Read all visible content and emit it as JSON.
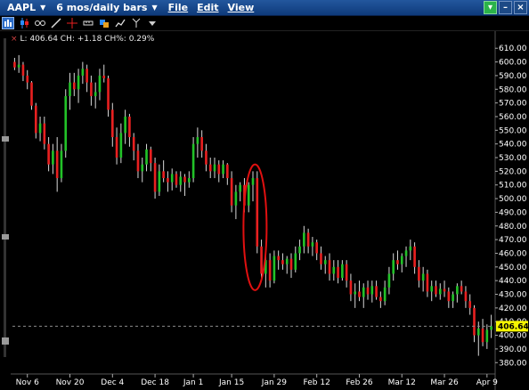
{
  "window": {
    "symbol": "AAPL",
    "period": "6 mos/daily bars",
    "menus": [
      "File",
      "Edit",
      "View"
    ]
  },
  "toolbar": {
    "icons": [
      "bar-chart-icon",
      "candlestick-icon",
      "link-icon",
      "line-icon",
      "crosshair-icon",
      "ruler-icon",
      "shape-icon",
      "trend-icon",
      "fork-icon",
      "dropdown-icon"
    ]
  },
  "status": {
    "close_marker": "×",
    "text": "L: 406.64 CH: +1.18 CH%: 0.29%"
  },
  "chart_data": {
    "type": "candlestick",
    "title": "",
    "last_price": "406.64",
    "ylim": [
      373,
      616
    ],
    "y_ticks": [
      "610.00",
      "600.00",
      "590.00",
      "580.00",
      "570.00",
      "560.00",
      "550.00",
      "540.00",
      "530.00",
      "520.00",
      "510.00",
      "500.00",
      "490.00",
      "480.00",
      "470.00",
      "460.00",
      "450.00",
      "440.00",
      "430.00",
      "420.00",
      "410.00",
      "400.00",
      "390.00",
      "380.00"
    ],
    "x_ticks": [
      {
        "label": "Nov 6",
        "index": 3
      },
      {
        "label": "Nov 20",
        "index": 13
      },
      {
        "label": "Dec 4",
        "index": 23
      },
      {
        "label": "Dec 18",
        "index": 33
      },
      {
        "label": "Jan 1",
        "index": 42
      },
      {
        "label": "Jan 15",
        "index": 51
      },
      {
        "label": "Jan 29",
        "index": 61
      },
      {
        "label": "Feb 12",
        "index": 71
      },
      {
        "label": "Feb 26",
        "index": 81
      },
      {
        "label": "Mar 12",
        "index": 91
      },
      {
        "label": "Mar 26",
        "index": 101
      },
      {
        "label": "Apr 9",
        "index": 111
      }
    ],
    "colors": {
      "up": "#22c228",
      "down": "#e82020",
      "highlight": "#e01010",
      "last_box": "#f5f500"
    },
    "candles": [
      [
        600,
        603,
        594,
        596
      ],
      [
        596,
        605,
        592,
        598
      ],
      [
        598,
        600,
        586,
        590
      ],
      [
        590,
        594,
        580,
        585
      ],
      [
        585,
        586,
        565,
        568
      ],
      [
        568,
        570,
        544,
        548
      ],
      [
        548,
        560,
        542,
        555
      ],
      [
        555,
        560,
        536,
        540
      ],
      [
        540,
        545,
        520,
        525
      ],
      [
        525,
        540,
        518,
        535
      ],
      [
        535,
        545,
        505,
        515
      ],
      [
        515,
        540,
        512,
        535
      ],
      [
        535,
        580,
        530,
        575
      ],
      [
        575,
        592,
        565,
        585
      ],
      [
        585,
        592,
        575,
        580
      ],
      [
        580,
        595,
        570,
        590
      ],
      [
        590,
        600,
        584,
        595
      ],
      [
        595,
        598,
        578,
        585
      ],
      [
        585,
        590,
        568,
        575
      ],
      [
        575,
        585,
        566,
        578
      ],
      [
        578,
        595,
        572,
        590
      ],
      [
        590,
        598,
        585,
        588
      ],
      [
        588,
        590,
        560,
        565
      ],
      [
        565,
        570,
        538,
        545
      ],
      [
        545,
        552,
        525,
        530
      ],
      [
        530,
        555,
        526,
        548
      ],
      [
        548,
        565,
        540,
        560
      ],
      [
        560,
        562,
        538,
        545
      ],
      [
        545,
        548,
        528,
        535
      ],
      [
        535,
        540,
        515,
        520
      ],
      [
        520,
        530,
        512,
        525
      ],
      [
        525,
        540,
        520,
        536
      ],
      [
        536,
        538,
        520,
        526
      ],
      [
        526,
        530,
        500,
        505
      ],
      [
        505,
        525,
        502,
        520
      ],
      [
        520,
        528,
        512,
        515
      ],
      [
        515,
        520,
        505,
        512
      ],
      [
        512,
        522,
        506,
        518
      ],
      [
        518,
        520,
        508,
        510
      ],
      [
        510,
        520,
        505,
        516
      ],
      [
        516,
        518,
        502,
        512
      ],
      [
        512,
        520,
        508,
        515
      ],
      [
        515,
        545,
        512,
        540
      ],
      [
        540,
        552,
        530,
        545
      ],
      [
        545,
        550,
        530,
        535
      ],
      [
        535,
        540,
        520,
        525
      ],
      [
        525,
        530,
        515,
        520
      ],
      [
        520,
        530,
        515,
        525
      ],
      [
        525,
        528,
        512,
        518
      ],
      [
        518,
        528,
        515,
        525
      ],
      [
        525,
        526,
        510,
        515
      ],
      [
        515,
        520,
        490,
        495
      ],
      [
        495,
        510,
        485,
        505
      ],
      [
        505,
        512,
        498,
        510
      ],
      [
        510,
        515,
        490,
        495
      ],
      [
        495,
        512,
        490,
        510
      ],
      [
        510,
        520,
        498,
        515
      ],
      [
        515,
        520,
        460,
        465
      ],
      [
        465,
        470,
        440,
        445
      ],
      [
        445,
        458,
        435,
        455
      ],
      [
        455,
        460,
        435,
        440
      ],
      [
        440,
        462,
        438,
        458
      ],
      [
        458,
        462,
        448,
        455
      ],
      [
        455,
        460,
        448,
        452
      ],
      [
        452,
        458,
        445,
        456
      ],
      [
        456,
        460,
        442,
        448
      ],
      [
        448,
        465,
        446,
        460
      ],
      [
        460,
        470,
        455,
        465
      ],
      [
        465,
        480,
        460,
        475
      ],
      [
        475,
        478,
        460,
        465
      ],
      [
        465,
        472,
        458,
        468
      ],
      [
        468,
        470,
        455,
        460
      ],
      [
        460,
        465,
        448,
        452
      ],
      [
        452,
        458,
        445,
        455
      ],
      [
        455,
        460,
        440,
        445
      ],
      [
        445,
        455,
        440,
        450
      ],
      [
        450,
        455,
        438,
        442
      ],
      [
        442,
        455,
        440,
        452
      ],
      [
        452,
        455,
        435,
        440
      ],
      [
        440,
        445,
        425,
        430
      ],
      [
        430,
        438,
        420,
        432
      ],
      [
        432,
        440,
        425,
        428
      ],
      [
        428,
        438,
        420,
        435
      ],
      [
        435,
        440,
        426,
        430
      ],
      [
        430,
        440,
        424,
        436
      ],
      [
        436,
        440,
        426,
        428
      ],
      [
        428,
        432,
        420,
        425
      ],
      [
        425,
        440,
        422,
        435
      ],
      [
        435,
        450,
        430,
        445
      ],
      [
        445,
        460,
        440,
        455
      ],
      [
        455,
        462,
        448,
        452
      ],
      [
        452,
        460,
        446,
        458
      ],
      [
        458,
        465,
        450,
        462
      ],
      [
        462,
        470,
        455,
        465
      ],
      [
        465,
        468,
        445,
        450
      ],
      [
        450,
        455,
        435,
        440
      ],
      [
        440,
        450,
        432,
        445
      ],
      [
        445,
        448,
        428,
        432
      ],
      [
        432,
        440,
        425,
        436
      ],
      [
        436,
        440,
        428,
        430
      ],
      [
        430,
        438,
        426,
        434
      ],
      [
        434,
        440,
        428,
        432
      ],
      [
        432,
        435,
        420,
        425
      ],
      [
        425,
        432,
        420,
        430
      ],
      [
        430,
        438,
        424,
        436
      ],
      [
        436,
        440,
        430,
        432
      ],
      [
        432,
        436,
        420,
        425
      ],
      [
        425,
        430,
        415,
        420
      ],
      [
        420,
        422,
        395,
        400
      ],
      [
        400,
        410,
        385,
        405
      ],
      [
        405,
        412,
        392,
        395
      ],
      [
        395,
        408,
        390,
        404
      ],
      [
        404,
        415,
        398,
        406.64
      ]
    ]
  }
}
